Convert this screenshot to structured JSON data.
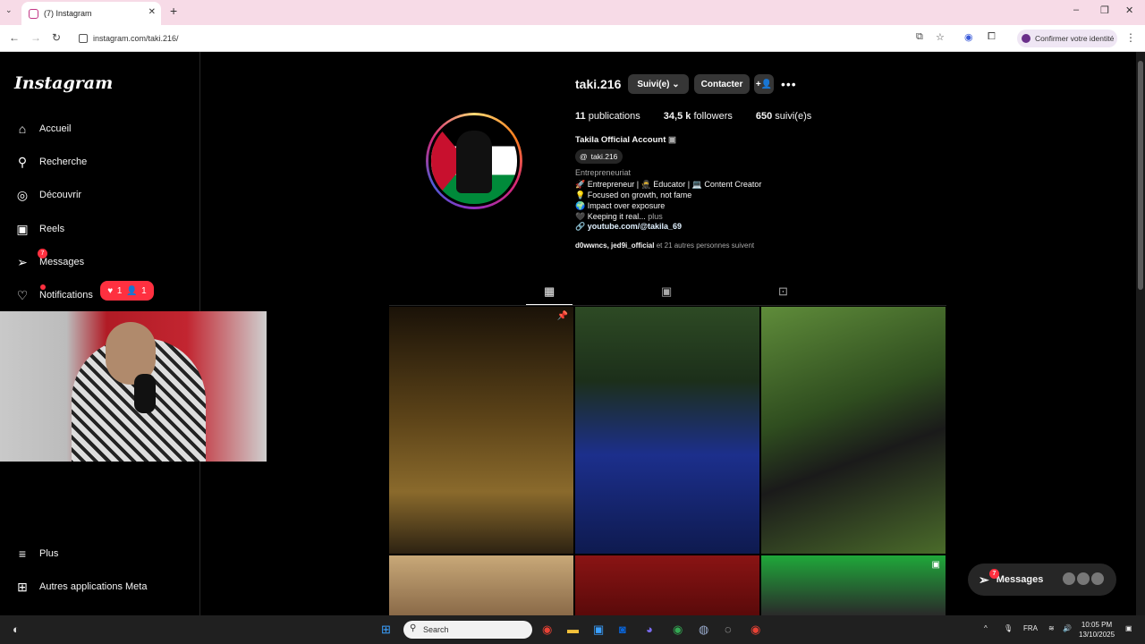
{
  "browser": {
    "tab_title": "(7) Instagram",
    "new_tab": "+",
    "url": "instagram.com/taki.216/",
    "identity_button": "Confirmer votre identité"
  },
  "sidebar": {
    "logo": "Instagram",
    "items": [
      {
        "label": "Accueil",
        "icon": "home-icon"
      },
      {
        "label": "Recherche",
        "icon": "search-icon"
      },
      {
        "label": "Découvrir",
        "icon": "compass-icon"
      },
      {
        "label": "Reels",
        "icon": "reels-icon"
      },
      {
        "label": "Messages",
        "icon": "messenger-icon",
        "badge": "7"
      },
      {
        "label": "Notifications",
        "icon": "heart-icon"
      }
    ],
    "notif_likes": "1",
    "notif_follows": "1",
    "bottom": [
      {
        "label": "Plus",
        "icon": "menu-icon"
      },
      {
        "label": "Autres applications Meta",
        "icon": "meta-apps-icon"
      }
    ]
  },
  "profile": {
    "username": "taki.216",
    "follow_button": "Suivi(e)",
    "contact_button": "Contacter",
    "stats": {
      "posts_count": "11",
      "posts_label": "publications",
      "followers_count": "34,5 k",
      "followers_label": "followers",
      "following_count": "650",
      "following_label": "suivi(e)s"
    },
    "full_name": "Takila Official Account",
    "threads_handle": "taki.216",
    "category": "Entrepreneuriat",
    "bio_lines": [
      "🚀 Entrepreneur | 🥷 Educator | 💻 Content Creator",
      "💡 Focused on growth, not fame",
      "🌍 Impact over exposure",
      "🖤 Keeping it real..."
    ],
    "bio_more": "plus",
    "link": "youtube.com/@takila_69",
    "followed_by_names": "d0wwncs, jed9i_official",
    "followed_by_rest": "et 21 autres personnes suivent"
  },
  "floating_messages": {
    "label": "Messages",
    "badge": "7"
  },
  "taskbar": {
    "search_placeholder": "Search",
    "language": "FRA",
    "time": "10:05 PM",
    "date": "13/10/2025"
  },
  "colors": {
    "background": "#000000",
    "notification_red": "#ff3040",
    "button_gray": "#363636",
    "browser_tabbar": "#f7dbe7"
  }
}
